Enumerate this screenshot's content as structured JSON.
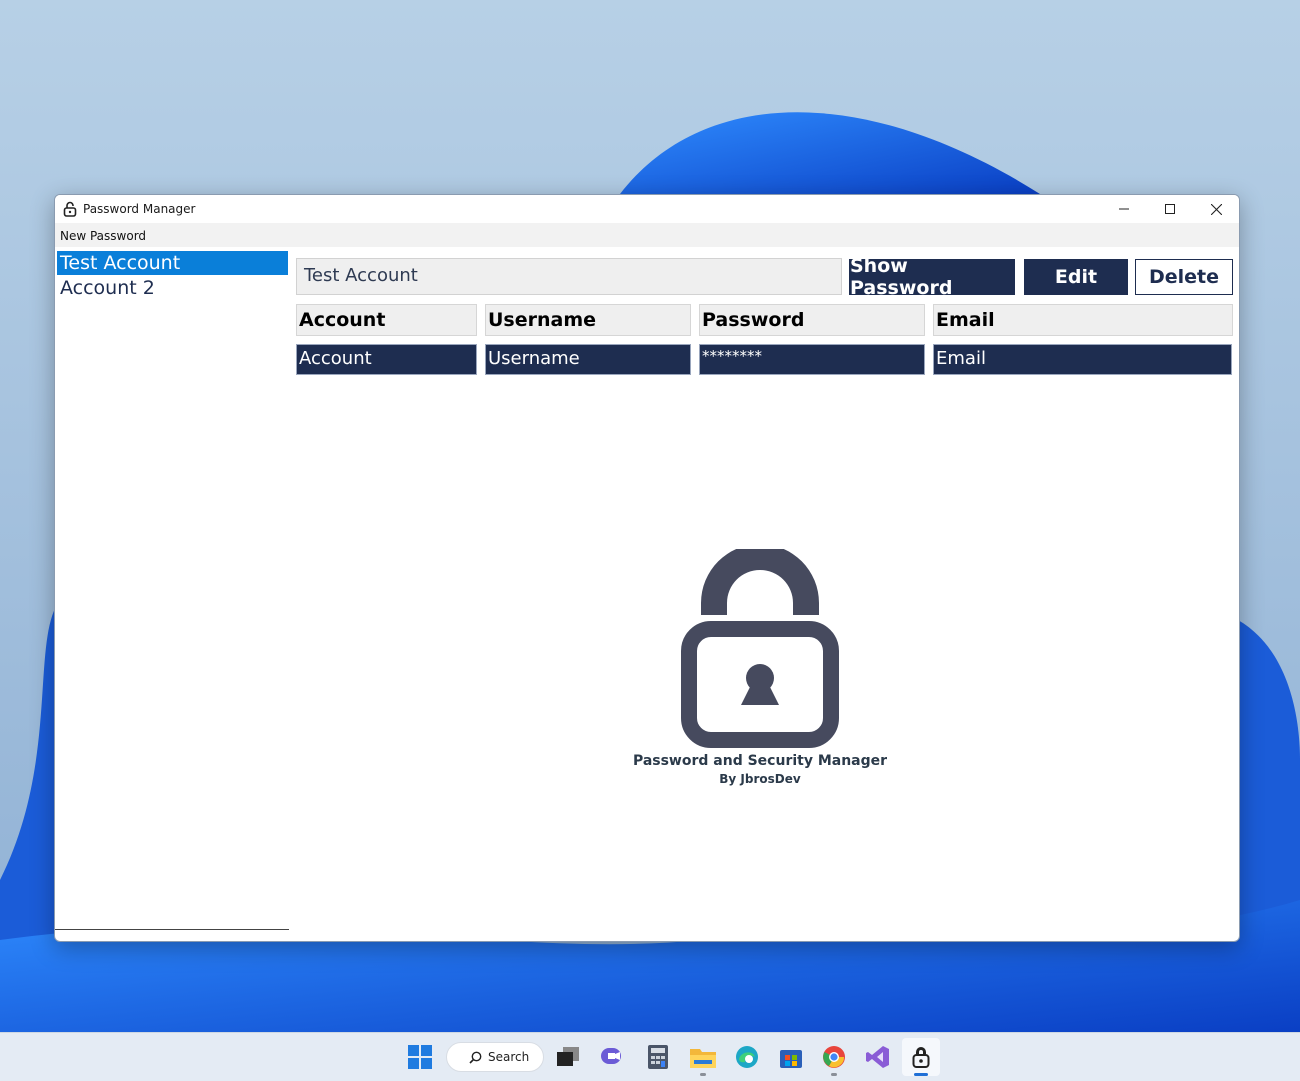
{
  "window": {
    "title": "Password Manager"
  },
  "menu": {
    "new_password": "New Password"
  },
  "accounts": {
    "items": [
      {
        "label": "Test Account",
        "selected": true
      },
      {
        "label": "Account 2",
        "selected": false
      }
    ]
  },
  "detail": {
    "account_name": "Test Account",
    "buttons": {
      "show_password": "Show Password",
      "edit": "Edit",
      "delete": "Delete"
    },
    "headers": [
      "Account",
      "Username",
      "Password",
      "Email"
    ],
    "values": [
      "Account",
      "Username",
      "********",
      "Email"
    ]
  },
  "branding": {
    "title": "Password and Security Manager",
    "subtitle": "By JbrosDev"
  },
  "taskbar": {
    "search_label": "Search",
    "icons": [
      "start-icon",
      "search-icon",
      "task-view-icon",
      "chat-icon",
      "calculator-icon",
      "file-explorer-icon",
      "edge-icon",
      "store-icon",
      "chrome-icon",
      "visual-studio-icon",
      "password-manager-icon"
    ]
  },
  "colors": {
    "accent_navy": "#1e2d50",
    "selection_blue": "#0a7fd9",
    "logo_gray": "#464a5e"
  }
}
